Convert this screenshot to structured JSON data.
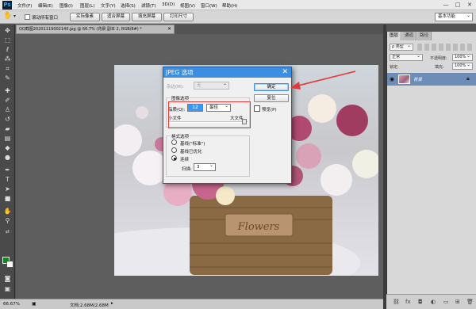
{
  "app": {
    "logo": "Ps"
  },
  "menu": [
    "文件(F)",
    "编辑(E)",
    "图像(I)",
    "图层(L)",
    "文字(Y)",
    "选择(S)",
    "滤镜(T)",
    "3D(D)",
    "视图(V)",
    "窗口(W)",
    "帮助(H)"
  ],
  "window_controls": {
    "minimize": "—",
    "maximize": "□",
    "close": "✕"
  },
  "options_bar": {
    "scroll_all_windows": "滚动所有窗口",
    "actual_pixels": "实际像素",
    "fit_screen": "适合屏幕",
    "fill_screen": "填充屏幕",
    "print_size": "打印尺寸",
    "workspace": "基本功能"
  },
  "document": {
    "tab_title": "QQ截图20201119002140.jpg @ 66.7% (背景 副本 2, RGB/8#) *",
    "photo_text": "Flowers"
  },
  "status": {
    "zoom": "66.67%",
    "doc_info": "文档:2.68M/2.68M"
  },
  "layers_panel": {
    "tabs": [
      "图层",
      "通道",
      "路径"
    ],
    "kind": "ρ 类型",
    "blend_mode": "正常",
    "opacity_label": "不透明度:",
    "opacity": "100%",
    "lock_label": "锁定:",
    "fill_label": "填充:",
    "fill": "100%",
    "layer_name": "背景"
  },
  "dialog": {
    "title": "JPEG 选项",
    "matte_label": "杂边(M):",
    "matte_value": "无",
    "image_options_title": "图像选项",
    "quality_label": "品质(Q):",
    "quality_value": "12",
    "quality_preset": "最佳",
    "small_file": "小文件",
    "large_file": "大文件",
    "format_options_title": "格式选项",
    "format_baseline_standard": "基线(\"标准\")",
    "format_baseline_optimized": "基线已优化",
    "format_progressive": "连续",
    "scan_label": "扫描:",
    "scan_value": "3",
    "ok": "确定",
    "reset": "复位",
    "preview": "预览(P)"
  },
  "colors": {
    "accent": "#3b8ee0",
    "annotation": "#e23a3a",
    "foreground": "#0a8a1f",
    "background": "#ffffff"
  },
  "icons": [
    "move-tool-icon",
    "marquee-tool-icon",
    "lasso-tool-icon",
    "magic-wand-icon",
    "crop-tool-icon",
    "eyedropper-icon",
    "healing-brush-icon",
    "brush-tool-icon",
    "clone-stamp-icon",
    "history-brush-icon",
    "eraser-icon",
    "gradient-tool-icon",
    "blur-tool-icon",
    "dodge-tool-icon",
    "pen-tool-icon",
    "type-tool-icon",
    "path-select-icon",
    "shape-tool-icon",
    "hand-tool-icon",
    "zoom-tool-icon",
    "eye-icon",
    "lock-icon"
  ]
}
